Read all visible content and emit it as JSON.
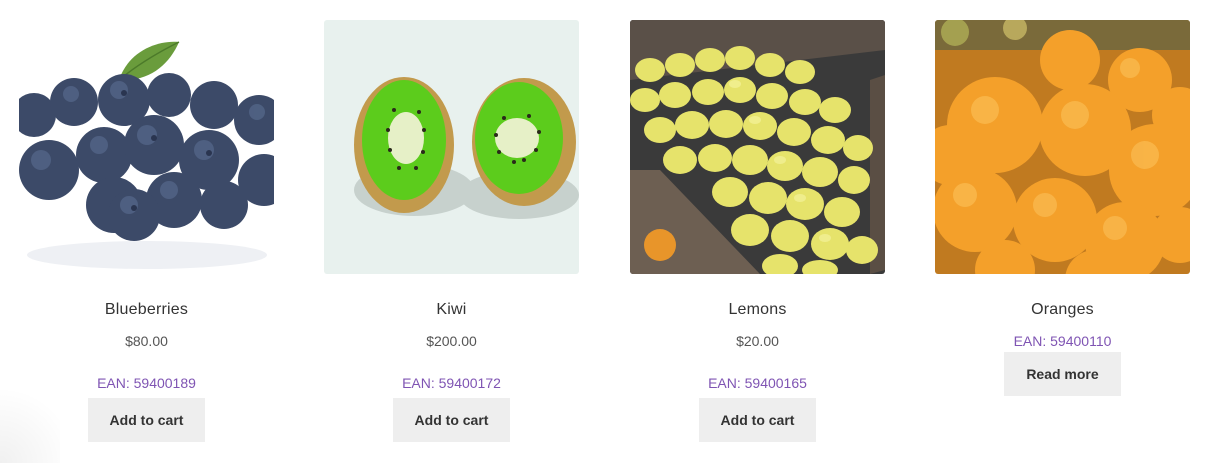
{
  "products": [
    {
      "name": "Blueberries",
      "image_icon": "blueberries-image",
      "price": "$80.00",
      "ean": "EAN: 59400189",
      "button": "Add to cart"
    },
    {
      "name": "Kiwi",
      "image_icon": "kiwi-image",
      "price": "$200.00",
      "ean": "EAN: 59400172",
      "button": "Add to cart"
    },
    {
      "name": "Lemons",
      "image_icon": "lemons-image",
      "price": "$20.00",
      "ean": "EAN: 59400165",
      "button": "Add to cart"
    },
    {
      "name": "Oranges",
      "image_icon": "oranges-image",
      "price": "",
      "ean": "EAN: 59400110",
      "button": "Read more"
    }
  ],
  "colors": {
    "ean_link": "#7f54b3",
    "button_bg": "#eeeeee",
    "text": "#333333"
  }
}
